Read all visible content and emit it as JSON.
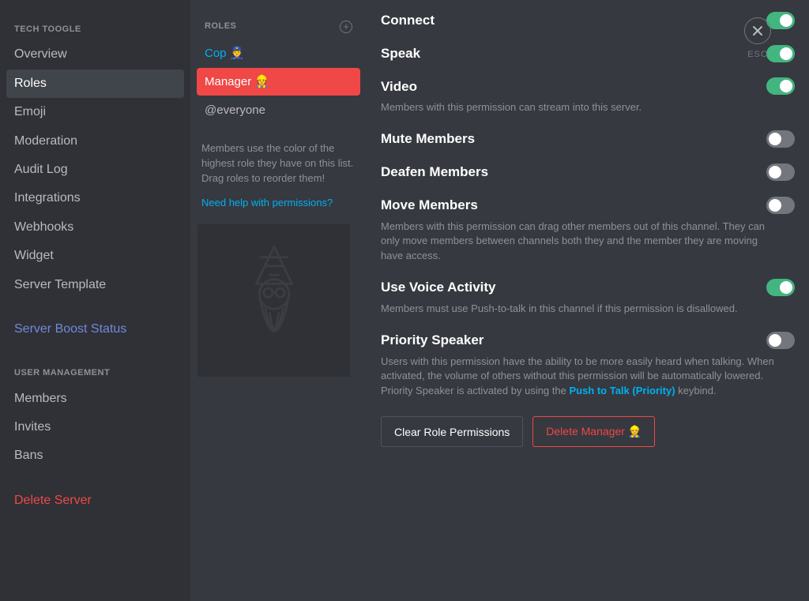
{
  "esc_label": "ESC",
  "sidebar": {
    "section1_title": "TECH TOOGLE",
    "items1": [
      {
        "label": "Overview"
      },
      {
        "label": "Roles"
      },
      {
        "label": "Emoji"
      },
      {
        "label": "Moderation"
      },
      {
        "label": "Audit Log"
      },
      {
        "label": "Integrations"
      },
      {
        "label": "Webhooks"
      },
      {
        "label": "Widget"
      },
      {
        "label": "Server Template"
      }
    ],
    "boost_label": "Server Boost Status",
    "section2_title": "USER MANAGEMENT",
    "items2": [
      {
        "label": "Members"
      },
      {
        "label": "Invites"
      },
      {
        "label": "Bans"
      }
    ],
    "delete_label": "Delete Server"
  },
  "roles": {
    "header": "ROLES",
    "items": [
      {
        "label": "Cop 👮"
      },
      {
        "label": "Manager 👷"
      },
      {
        "label": "@everyone"
      }
    ],
    "note": "Members use the color of the highest role they have on this list. Drag roles to reorder them!",
    "help": "Need help with permissions?"
  },
  "permissions": [
    {
      "title": "Connect",
      "on": true
    },
    {
      "title": "Speak",
      "on": true
    },
    {
      "title": "Video",
      "on": true,
      "desc_plain": "Members with this permission can stream into this server."
    },
    {
      "title": "Mute Members",
      "on": false
    },
    {
      "title": "Deafen Members",
      "on": false
    },
    {
      "title": "Move Members",
      "on": false,
      "desc_plain": "Members with this permission can drag other members out of this channel. They can only move members between channels both they and the member they are moving have access."
    },
    {
      "title": "Use Voice Activity",
      "on": true,
      "desc_plain": "Members must use Push-to-talk in this channel if this permission is disallowed."
    },
    {
      "title": "Priority Speaker",
      "on": false,
      "desc_pre": "Users with this permission have the ability to be more easily heard when talking. When activated, the volume of others without this permission will be automatically lowered. Priority Speaker is activated by using the ",
      "desc_link": "Push to Talk (Priority)",
      "desc_post": " keybind."
    }
  ],
  "buttons": {
    "clear": "Clear Role Permissions",
    "delete": "Delete Manager 👷"
  }
}
